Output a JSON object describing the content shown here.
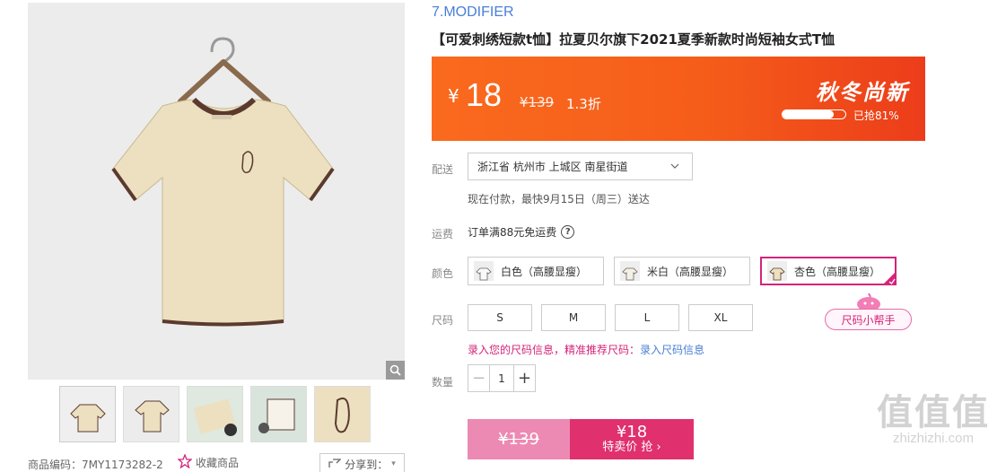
{
  "product": {
    "brand": "7.MODIFIER",
    "title": "【可爱刺绣短款t恤】拉夏贝尔旗下2021夏季新款时尚短袖女式T恤",
    "sku_code": "商品编码：7MY1173282-2",
    "favorite_label": "收藏商品",
    "share_label": "分享到："
  },
  "price_banner": {
    "currency": "¥",
    "current_price": "18",
    "original_price": "¥139",
    "discount": "1.3折",
    "promo_title": "秋冬尚新",
    "sold_percent": 81,
    "progress_label": "已抢81%"
  },
  "delivery": {
    "label": "配送",
    "address": "浙江省 杭州市 上城区 南星街道",
    "estimate": "现在付款，最快9月15日（周三）送达"
  },
  "shipping_fee": {
    "label": "运费",
    "text": "订单满88元免运费",
    "help_icon": "?"
  },
  "colors": {
    "label": "颜色",
    "options": [
      {
        "label": "白色（高腰显瘦）"
      },
      {
        "label": "米白（高腰显瘦）"
      },
      {
        "label": "杏色（高腰显瘦）"
      }
    ],
    "selected": "杏色（高腰显瘦）"
  },
  "sizes": {
    "label": "尺码",
    "options": [
      "S",
      "M",
      "L",
      "XL"
    ],
    "helper": "尺码小帮手",
    "hint_prefix": "录入您的尺码信息，",
    "hint_middle": "精准推荐尺码：",
    "hint_link": "录入尺码信息"
  },
  "quantity": {
    "label": "数量",
    "value": "1",
    "minus": "−",
    "plus": "+"
  },
  "buy": {
    "original_price": "¥139",
    "price": "¥18",
    "label": "特卖价 抢 ›"
  },
  "watermark": {
    "logo": "值值值",
    "url": "zhizhizhi.com"
  },
  "colors_theme": {
    "accent": "#e0306e",
    "banner": "#f55d1a",
    "brand_link": "#4a7fd6"
  }
}
